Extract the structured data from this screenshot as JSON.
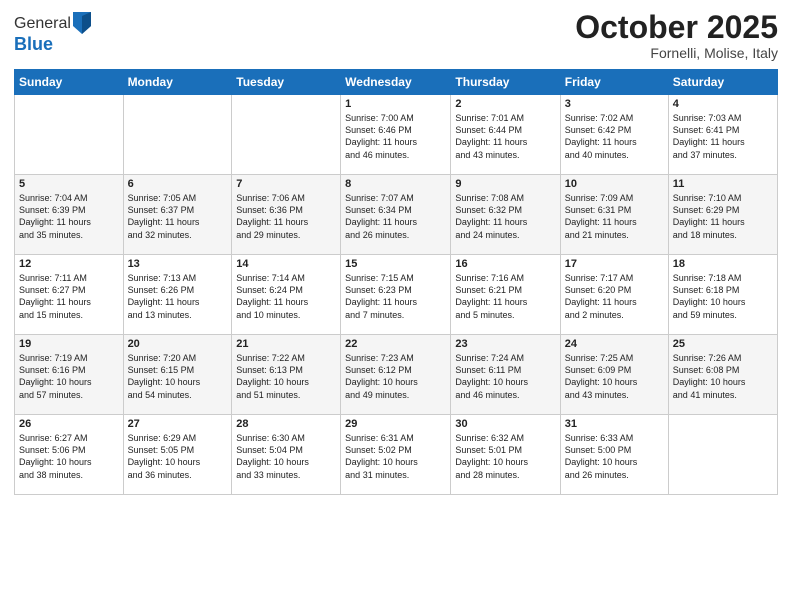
{
  "header": {
    "logo_general": "General",
    "logo_blue": "Blue",
    "month": "October 2025",
    "location": "Fornelli, Molise, Italy"
  },
  "weekdays": [
    "Sunday",
    "Monday",
    "Tuesday",
    "Wednesday",
    "Thursday",
    "Friday",
    "Saturday"
  ],
  "weeks": [
    [
      {
        "num": "",
        "info": ""
      },
      {
        "num": "",
        "info": ""
      },
      {
        "num": "",
        "info": ""
      },
      {
        "num": "1",
        "info": "Sunrise: 7:00 AM\nSunset: 6:46 PM\nDaylight: 11 hours\nand 46 minutes."
      },
      {
        "num": "2",
        "info": "Sunrise: 7:01 AM\nSunset: 6:44 PM\nDaylight: 11 hours\nand 43 minutes."
      },
      {
        "num": "3",
        "info": "Sunrise: 7:02 AM\nSunset: 6:42 PM\nDaylight: 11 hours\nand 40 minutes."
      },
      {
        "num": "4",
        "info": "Sunrise: 7:03 AM\nSunset: 6:41 PM\nDaylight: 11 hours\nand 37 minutes."
      }
    ],
    [
      {
        "num": "5",
        "info": "Sunrise: 7:04 AM\nSunset: 6:39 PM\nDaylight: 11 hours\nand 35 minutes."
      },
      {
        "num": "6",
        "info": "Sunrise: 7:05 AM\nSunset: 6:37 PM\nDaylight: 11 hours\nand 32 minutes."
      },
      {
        "num": "7",
        "info": "Sunrise: 7:06 AM\nSunset: 6:36 PM\nDaylight: 11 hours\nand 29 minutes."
      },
      {
        "num": "8",
        "info": "Sunrise: 7:07 AM\nSunset: 6:34 PM\nDaylight: 11 hours\nand 26 minutes."
      },
      {
        "num": "9",
        "info": "Sunrise: 7:08 AM\nSunset: 6:32 PM\nDaylight: 11 hours\nand 24 minutes."
      },
      {
        "num": "10",
        "info": "Sunrise: 7:09 AM\nSunset: 6:31 PM\nDaylight: 11 hours\nand 21 minutes."
      },
      {
        "num": "11",
        "info": "Sunrise: 7:10 AM\nSunset: 6:29 PM\nDaylight: 11 hours\nand 18 minutes."
      }
    ],
    [
      {
        "num": "12",
        "info": "Sunrise: 7:11 AM\nSunset: 6:27 PM\nDaylight: 11 hours\nand 15 minutes."
      },
      {
        "num": "13",
        "info": "Sunrise: 7:13 AM\nSunset: 6:26 PM\nDaylight: 11 hours\nand 13 minutes."
      },
      {
        "num": "14",
        "info": "Sunrise: 7:14 AM\nSunset: 6:24 PM\nDaylight: 11 hours\nand 10 minutes."
      },
      {
        "num": "15",
        "info": "Sunrise: 7:15 AM\nSunset: 6:23 PM\nDaylight: 11 hours\nand 7 minutes."
      },
      {
        "num": "16",
        "info": "Sunrise: 7:16 AM\nSunset: 6:21 PM\nDaylight: 11 hours\nand 5 minutes."
      },
      {
        "num": "17",
        "info": "Sunrise: 7:17 AM\nSunset: 6:20 PM\nDaylight: 11 hours\nand 2 minutes."
      },
      {
        "num": "18",
        "info": "Sunrise: 7:18 AM\nSunset: 6:18 PM\nDaylight: 10 hours\nand 59 minutes."
      }
    ],
    [
      {
        "num": "19",
        "info": "Sunrise: 7:19 AM\nSunset: 6:16 PM\nDaylight: 10 hours\nand 57 minutes."
      },
      {
        "num": "20",
        "info": "Sunrise: 7:20 AM\nSunset: 6:15 PM\nDaylight: 10 hours\nand 54 minutes."
      },
      {
        "num": "21",
        "info": "Sunrise: 7:22 AM\nSunset: 6:13 PM\nDaylight: 10 hours\nand 51 minutes."
      },
      {
        "num": "22",
        "info": "Sunrise: 7:23 AM\nSunset: 6:12 PM\nDaylight: 10 hours\nand 49 minutes."
      },
      {
        "num": "23",
        "info": "Sunrise: 7:24 AM\nSunset: 6:11 PM\nDaylight: 10 hours\nand 46 minutes."
      },
      {
        "num": "24",
        "info": "Sunrise: 7:25 AM\nSunset: 6:09 PM\nDaylight: 10 hours\nand 43 minutes."
      },
      {
        "num": "25",
        "info": "Sunrise: 7:26 AM\nSunset: 6:08 PM\nDaylight: 10 hours\nand 41 minutes."
      }
    ],
    [
      {
        "num": "26",
        "info": "Sunrise: 6:27 AM\nSunset: 5:06 PM\nDaylight: 10 hours\nand 38 minutes."
      },
      {
        "num": "27",
        "info": "Sunrise: 6:29 AM\nSunset: 5:05 PM\nDaylight: 10 hours\nand 36 minutes."
      },
      {
        "num": "28",
        "info": "Sunrise: 6:30 AM\nSunset: 5:04 PM\nDaylight: 10 hours\nand 33 minutes."
      },
      {
        "num": "29",
        "info": "Sunrise: 6:31 AM\nSunset: 5:02 PM\nDaylight: 10 hours\nand 31 minutes."
      },
      {
        "num": "30",
        "info": "Sunrise: 6:32 AM\nSunset: 5:01 PM\nDaylight: 10 hours\nand 28 minutes."
      },
      {
        "num": "31",
        "info": "Sunrise: 6:33 AM\nSunset: 5:00 PM\nDaylight: 10 hours\nand 26 minutes."
      },
      {
        "num": "",
        "info": ""
      }
    ]
  ]
}
